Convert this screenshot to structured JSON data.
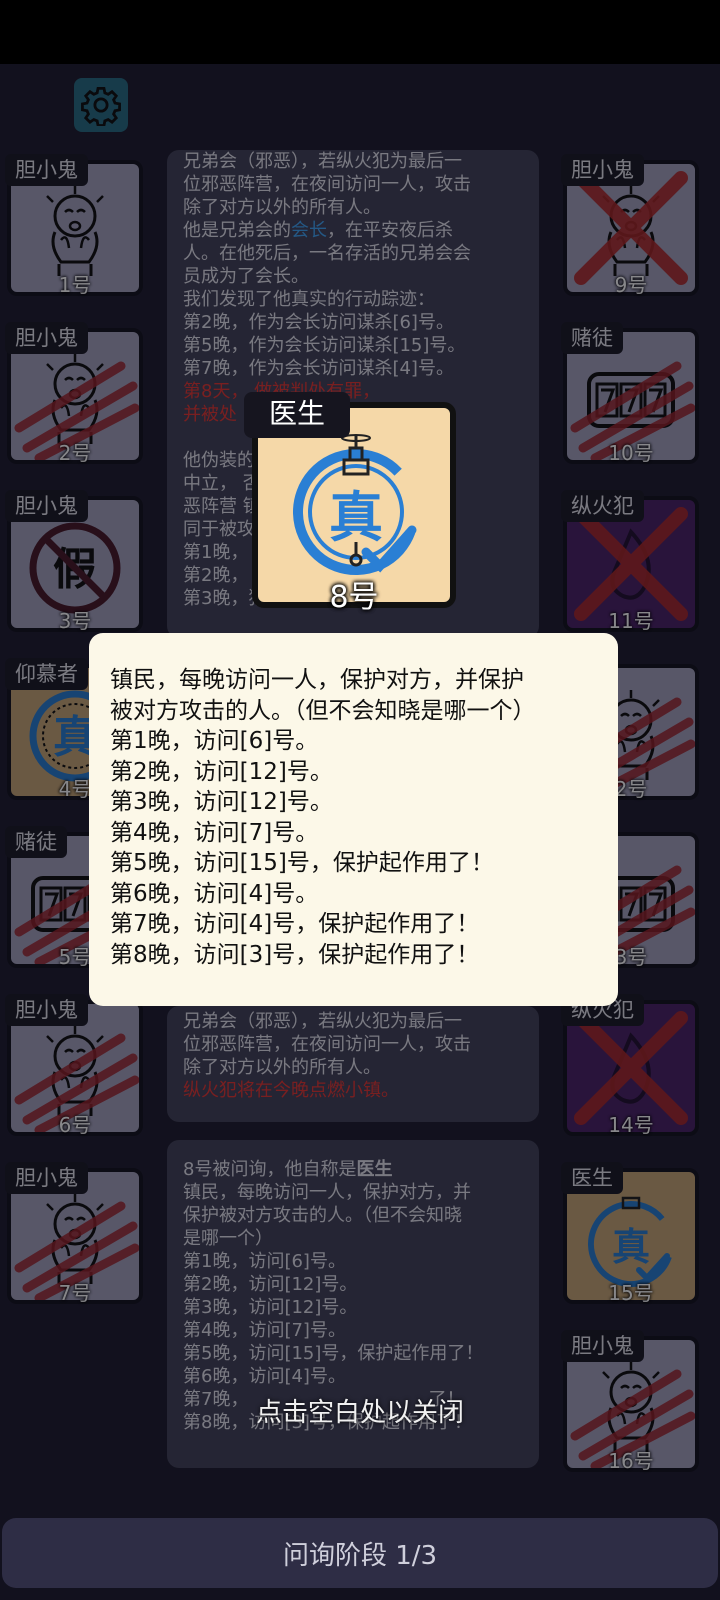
{
  "settings": {
    "icon": "gear-icon"
  },
  "left_cards": [
    {
      "role": "胆小鬼",
      "number": "1号",
      "state": "alive",
      "art": "scared-face"
    },
    {
      "role": "胆小鬼",
      "number": "2号",
      "state": "dead",
      "art": "scared-face"
    },
    {
      "role": "胆小鬼",
      "number": "3号",
      "state": "fake",
      "art": "fake-stamp"
    },
    {
      "role": "仰慕者",
      "number": "4号",
      "state": "alive",
      "art": "true-stamp"
    },
    {
      "role": "赌徒",
      "number": "5号",
      "state": "dead",
      "art": "slot-777"
    },
    {
      "role": "胆小鬼",
      "number": "6号",
      "state": "dead",
      "art": "scared-face"
    },
    {
      "role": "胆小鬼",
      "number": "7号",
      "state": "dead",
      "art": "scared-face"
    }
  ],
  "right_cards": [
    {
      "role": "胆小鬼",
      "number": "9号",
      "state": "dead-x",
      "art": "scared-face"
    },
    {
      "role": "赌徒",
      "number": "10号",
      "state": "dead",
      "art": "slot-777"
    },
    {
      "role": "纵火犯",
      "number": "11号",
      "state": "dead-x",
      "art": "fire"
    },
    {
      "role": "鬼",
      "number": "2号",
      "state": "dead",
      "art": "scared-face"
    },
    {
      "role": "",
      "number": "3号",
      "state": "dead",
      "art": "slot-777"
    },
    {
      "role": "纵火犯",
      "number": "14号",
      "state": "dead-x",
      "art": "fire"
    },
    {
      "role": "医生",
      "number": "15号",
      "state": "alive",
      "art": "true-check"
    },
    {
      "role": "胆小鬼",
      "number": "16号",
      "state": "dead",
      "art": "scared-face"
    }
  ],
  "log1": [
    {
      "text": "兄弟会（邪恶），若纵火犯为最后一",
      "style": ""
    },
    {
      "text": "位邪恶阵营，在夜间访问一人，攻击",
      "style": ""
    },
    {
      "text": "除了对方以外的所有人。",
      "style": ""
    },
    {
      "text": "他是兄弟会的",
      "style": "",
      "highlight": "会长",
      "tail": "，在平安夜后杀"
    },
    {
      "text": "人。在他死后，一名存活的兄弟会会",
      "style": ""
    },
    {
      "text": "员成为了会长。",
      "style": ""
    },
    {
      "text": "我们发现了他真实的行动踪迹：",
      "style": ""
    },
    {
      "text": "第2晚，作为会长访问谋杀[6]号。",
      "style": ""
    },
    {
      "text": "第5晚，作为会长访问谋杀[15]号。",
      "style": ""
    },
    {
      "text": "第7晚，作为会长访问谋杀[4]号。",
      "style": ""
    },
    {
      "text": "第8天，                  做被判处有罪，",
      "style": "red"
    },
    {
      "text": "并被处",
      "style": "red"
    },
    {
      "text": "",
      "style": ""
    },
    {
      "text": "他伪装的                               ",
      "style": ""
    },
    {
      "text": "中立，                          否为邪",
      "style": ""
    },
    {
      "text": "恶阵营                          镇（等",
      "style": ""
    },
    {
      "text": "同于被攻",
      "style": ""
    },
    {
      "text": "第1晚，",
      "style": ""
    },
    {
      "text": "第2晚，",
      "style": ""
    },
    {
      "text": "第3晚，猜测[3]号不是邪恶。",
      "style": ""
    }
  ],
  "log2": [
    {
      "text": "兄弟会（邪恶），若纵火犯为最后一",
      "style": ""
    },
    {
      "text": "位邪恶阵营，在夜间访问一人，攻击",
      "style": ""
    },
    {
      "text": "除了对方以外的所有人。",
      "style": ""
    },
    {
      "text": "纵火犯将在今晚点燃小镇。",
      "style": "red"
    }
  ],
  "log3": [
    {
      "text": "8号被问询，他自称是",
      "style": "",
      "bold": "医生"
    },
    {
      "text": "镇民，每晚访问一人，保护对方，并",
      "style": ""
    },
    {
      "text": "保护被对方攻击的人。（但不会知晓",
      "style": ""
    },
    {
      "text": "是哪一个）",
      "style": ""
    },
    {
      "text": "第1晚，访问[6]号。",
      "style": ""
    },
    {
      "text": "第2晚，访问[12]号。",
      "style": ""
    },
    {
      "text": "第3晚，访问[12]号。",
      "style": ""
    },
    {
      "text": "第4晚，访问[7]号。",
      "style": ""
    },
    {
      "text": "第5晚，访问[15]号，保护起作用了！",
      "style": ""
    },
    {
      "text": "第6晚，访问[4]号。",
      "style": ""
    },
    {
      "text": "第7晚，",
      "style": "",
      "tail": "了！"
    },
    {
      "text": "第8晚，访问[3]号，保护起作用了！",
      "style": ""
    }
  ],
  "popup_card": {
    "role": "医生",
    "number": "8号",
    "stamp": "真"
  },
  "tooltip": {
    "lines": [
      "镇民，每晚访问一人，保护对方，并保护",
      "被对方攻击的人。（但不会知晓是哪一个）",
      "第1晚，访问[6]号。",
      "第2晚，访问[12]号。",
      "第3晚，访问[12]号。",
      "第4晚，访问[7]号。",
      "第5晚，访问[15]号，保护起作用了！",
      "第6晚，访问[4]号。",
      "第7晚，访问[4]号，保护起作用了！",
      "第8晚，访问[3]号，保护起作用了！"
    ]
  },
  "close_hint": "点击空白处以关闭",
  "phase": "问询阶段 1/3",
  "colors": {
    "accent_blue": "#2a7fd4",
    "dead_red": "#b02a2a",
    "tooltip_bg": "#fcf8e8"
  }
}
